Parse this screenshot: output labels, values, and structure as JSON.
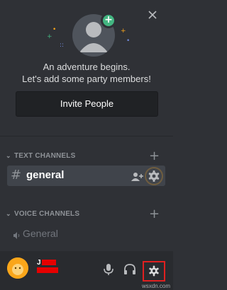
{
  "welcome": {
    "line1": "An adventure begins.",
    "line2": "Let's add some party members!",
    "invite_label": "Invite People"
  },
  "categories": {
    "text": {
      "label": "TEXT CHANNELS"
    },
    "voice": {
      "label": "VOICE CHANNELS"
    }
  },
  "channels": {
    "text": [
      {
        "prefix": "#",
        "name": "general"
      }
    ],
    "voice": [
      {
        "name": "General"
      }
    ]
  },
  "user": {
    "name_visible": "J"
  },
  "watermark": "wsxdn.com",
  "colors": {
    "background": "#2f3136",
    "accent_green": "#43b581",
    "active_channel": "#40444b",
    "user_avatar": "#faa61a",
    "highlight": "#e02020",
    "redaction": "#e60000"
  },
  "icons": {
    "close": "close-icon",
    "add": "plus-icon",
    "invite_user": "add-user-icon",
    "settings": "gear-icon",
    "mic": "microphone-icon",
    "headphones": "headphones-icon",
    "speaker": "speaker-icon"
  }
}
